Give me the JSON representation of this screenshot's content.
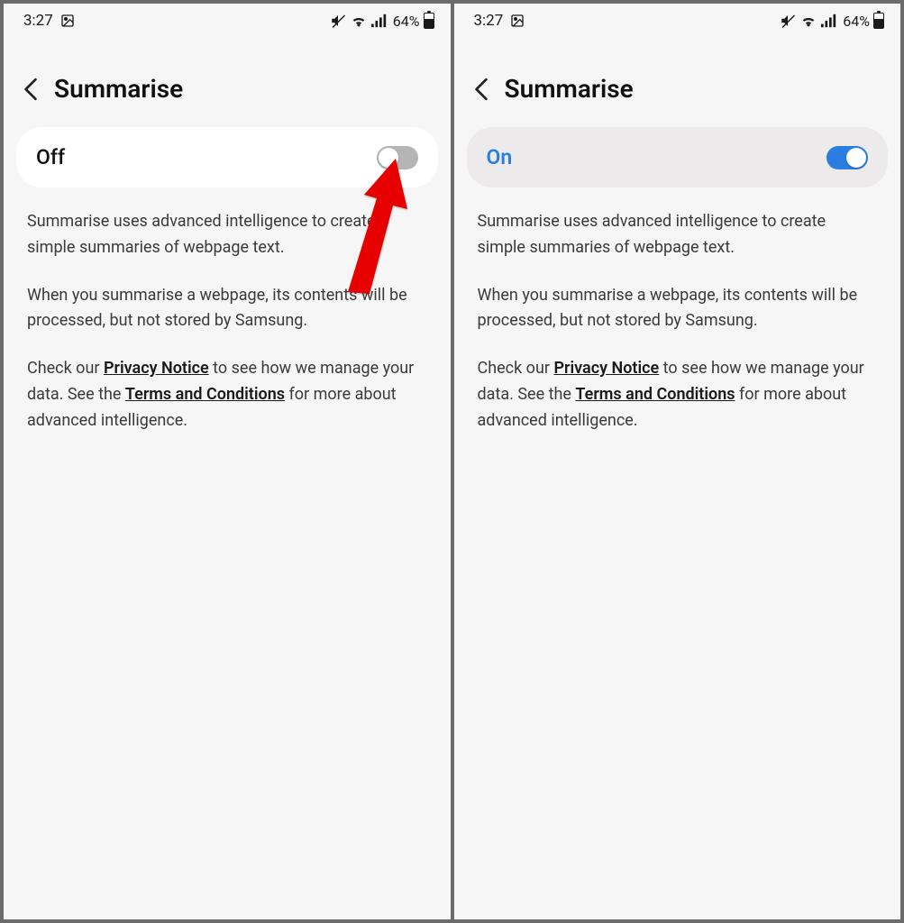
{
  "shared": {
    "status": {
      "time": "3:27",
      "battery_percent": "64%",
      "battery_level": 0.64
    },
    "page_title": "Summarise",
    "desc_para1": "Summarise uses advanced intelligence to create simple summaries of webpage text.",
    "desc_para2": "When you summarise a webpage, its contents will be processed, but not stored by Samsung.",
    "desc_para3_pre": "Check our ",
    "privacy_link": "Privacy Notice",
    "desc_para3_mid": " to see how we manage your data. See the ",
    "terms_link": "Terms and Conditions",
    "desc_para3_post": " for more about advanced intelligence."
  },
  "left": {
    "toggle_label": "Off",
    "toggle_state": "off",
    "card_bg": "white"
  },
  "right": {
    "toggle_label": "On",
    "toggle_state": "on",
    "card_bg": "grey"
  }
}
